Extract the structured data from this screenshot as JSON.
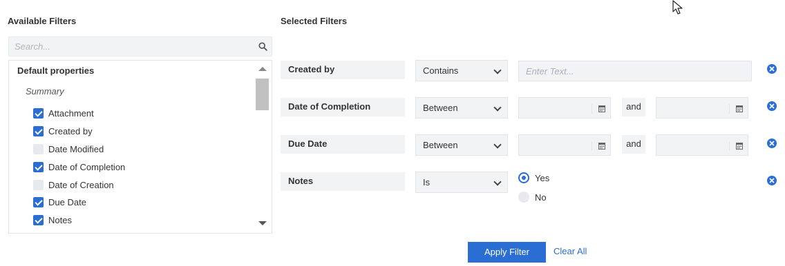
{
  "available_filters": {
    "title": "Available Filters",
    "search_placeholder": "Search...",
    "group_label": "Default properties",
    "subgroup_label": "Summary",
    "items": [
      {
        "label": "Attachment",
        "checked": true
      },
      {
        "label": "Created by",
        "checked": true
      },
      {
        "label": "Date Modified",
        "checked": false
      },
      {
        "label": "Date of Completion",
        "checked": true
      },
      {
        "label": "Date of Creation",
        "checked": false
      },
      {
        "label": "Due Date",
        "checked": true
      },
      {
        "label": "Notes",
        "checked": true
      }
    ]
  },
  "selected_filters": {
    "title": "Selected Filters",
    "rows": [
      {
        "name": "Created by",
        "operator": "Contains",
        "input_placeholder": "Enter Text..."
      },
      {
        "name": "Date of Completion",
        "operator": "Between",
        "and_label": "and"
      },
      {
        "name": "Due Date",
        "operator": "Between",
        "and_label": "and"
      },
      {
        "name": "Notes",
        "operator": "Is",
        "options": [
          {
            "label": "Yes",
            "selected": true
          },
          {
            "label": "No",
            "selected": false
          }
        ]
      }
    ]
  },
  "actions": {
    "apply_label": "Apply Filter",
    "clear_label": "Clear All"
  },
  "colors": {
    "accent": "#2a6ed4",
    "field_bg": "#f1f3f5"
  }
}
